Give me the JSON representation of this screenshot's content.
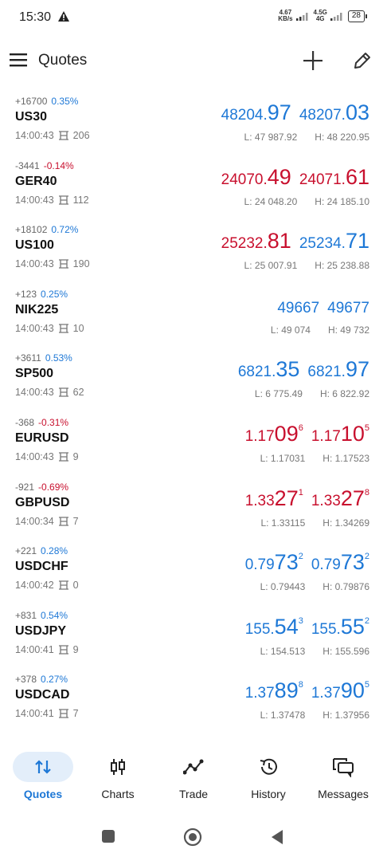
{
  "status_bar": {
    "time": "15:30",
    "net_speed_top": "4.67",
    "net_speed_unit": "KB/s",
    "network_label_top": "4.5G",
    "network_label_bottom": "4G",
    "battery": "28"
  },
  "header": {
    "title": "Quotes"
  },
  "quotes": [
    {
      "change": "+16700",
      "pct": "0.35%",
      "pct_color": "blue",
      "symbol": "US30",
      "time": "14:00:43",
      "spread": "206",
      "bid": {
        "small": "48204.",
        "big": "97",
        "sup": "",
        "color": "blue"
      },
      "ask": {
        "small": "48207.",
        "big": "03",
        "sup": "",
        "color": "blue"
      },
      "low": "L: 47 987.92",
      "high": "H: 48 220.95"
    },
    {
      "change": "-3441",
      "pct": "-0.14%",
      "pct_color": "red",
      "symbol": "GER40",
      "time": "14:00:43",
      "spread": "112",
      "bid": {
        "small": "24070.",
        "big": "49",
        "sup": "",
        "color": "red"
      },
      "ask": {
        "small": "24071.",
        "big": "61",
        "sup": "",
        "color": "red"
      },
      "low": "L: 24 048.20",
      "high": "H: 24 185.10"
    },
    {
      "change": "+18102",
      "pct": "0.72%",
      "pct_color": "blue",
      "symbol": "US100",
      "time": "14:00:43",
      "spread": "190",
      "bid": {
        "small": "25232.",
        "big": "81",
        "sup": "",
        "color": "red"
      },
      "ask": {
        "small": "25234.",
        "big": "71",
        "sup": "",
        "color": "blue"
      },
      "low": "L: 25 007.91",
      "high": "H: 25 238.88"
    },
    {
      "change": "+123",
      "pct": "0.25%",
      "pct_color": "blue",
      "symbol": "NIK225",
      "time": "14:00:43",
      "spread": "10",
      "bid": {
        "small": "49667",
        "big": "",
        "sup": "",
        "color": "blue"
      },
      "ask": {
        "small": "49677",
        "big": "",
        "sup": "",
        "color": "blue"
      },
      "low": "L: 49 074",
      "high": "H: 49 732"
    },
    {
      "change": "+3611",
      "pct": "0.53%",
      "pct_color": "blue",
      "symbol": "SP500",
      "time": "14:00:43",
      "spread": "62",
      "bid": {
        "small": "6821.",
        "big": "35",
        "sup": "",
        "color": "blue"
      },
      "ask": {
        "small": "6821.",
        "big": "97",
        "sup": "",
        "color": "blue"
      },
      "low": "L: 6 775.49",
      "high": "H: 6 822.92"
    },
    {
      "change": "-368",
      "pct": "-0.31%",
      "pct_color": "red",
      "symbol": "EURUSD",
      "time": "14:00:43",
      "spread": "9",
      "bid": {
        "small": "1.17",
        "big": "09",
        "sup": "6",
        "color": "red"
      },
      "ask": {
        "small": "1.17",
        "big": "10",
        "sup": "5",
        "color": "red"
      },
      "low": "L: 1.17031",
      "high": "H: 1.17523"
    },
    {
      "change": "-921",
      "pct": "-0.69%",
      "pct_color": "red",
      "symbol": "GBPUSD",
      "time": "14:00:34",
      "spread": "7",
      "bid": {
        "small": "1.33",
        "big": "27",
        "sup": "1",
        "color": "red"
      },
      "ask": {
        "small": "1.33",
        "big": "27",
        "sup": "8",
        "color": "red"
      },
      "low": "L: 1.33115",
      "high": "H: 1.34269"
    },
    {
      "change": "+221",
      "pct": "0.28%",
      "pct_color": "blue",
      "symbol": "USDCHF",
      "time": "14:00:42",
      "spread": "0",
      "bid": {
        "small": "0.79",
        "big": "73",
        "sup": "2",
        "color": "blue"
      },
      "ask": {
        "small": "0.79",
        "big": "73",
        "sup": "2",
        "color": "blue"
      },
      "low": "L: 0.79443",
      "high": "H: 0.79876"
    },
    {
      "change": "+831",
      "pct": "0.54%",
      "pct_color": "blue",
      "symbol": "USDJPY",
      "time": "14:00:41",
      "spread": "9",
      "bid": {
        "small": "155.",
        "big": "54",
        "sup": "3",
        "color": "blue"
      },
      "ask": {
        "small": "155.",
        "big": "55",
        "sup": "2",
        "color": "blue"
      },
      "low": "L: 154.513",
      "high": "H: 155.596"
    },
    {
      "change": "+378",
      "pct": "0.27%",
      "pct_color": "blue",
      "symbol": "USDCAD",
      "time": "14:00:41",
      "spread": "7",
      "bid": {
        "small": "1.37",
        "big": "89",
        "sup": "8",
        "color": "blue"
      },
      "ask": {
        "small": "1.37",
        "big": "90",
        "sup": "5",
        "color": "blue"
      },
      "low": "L: 1.37478",
      "high": "H: 1.37956"
    }
  ],
  "bottom_nav": {
    "items": [
      {
        "label": "Quotes",
        "icon": "quotes-arrows-icon",
        "active": true
      },
      {
        "label": "Charts",
        "icon": "candlestick-icon",
        "active": false
      },
      {
        "label": "Trade",
        "icon": "trade-line-icon",
        "active": false
      },
      {
        "label": "History",
        "icon": "history-icon",
        "active": false
      },
      {
        "label": "Messages",
        "icon": "messages-icon",
        "active": false
      }
    ]
  },
  "colors": {
    "accent_blue": "#1e78d6",
    "down_red": "#c8102e",
    "nav_active_bg": "#e3eefa"
  }
}
